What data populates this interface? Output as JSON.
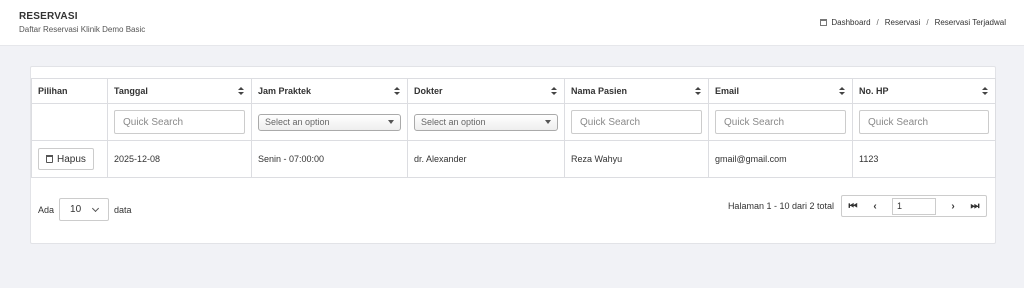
{
  "header": {
    "title": "RESERVASI",
    "subtitle": "Daftar Reservasi Klinik Demo Basic",
    "breadcrumb": [
      "Dashboard",
      "Reservasi",
      "Reservasi Terjadwal"
    ]
  },
  "table": {
    "columns": [
      "Pilihan",
      "Tanggal",
      "Jam Praktek",
      "Dokter",
      "Nama Pasien",
      "Email",
      "No. HP"
    ],
    "filters": {
      "quick_search_placeholder": "Quick Search",
      "select_placeholder": "Select an option"
    },
    "rows": [
      {
        "action": "Hapus",
        "tanggal": "2025-12-08",
        "jam_praktek": "Senin - 07:00:00",
        "dokter": "dr. Alexander",
        "nama_pasien": "Reza Wahyu",
        "email": "gmail@gmail.com",
        "no_hp": "1123"
      }
    ]
  },
  "footer": {
    "length_prefix": "Ada",
    "length_value": "10",
    "length_suffix": "data",
    "page_info": "Halaman 1 - 10 dari 2 total",
    "page_input_value": "1"
  },
  "icons": {
    "first": "⏮",
    "prev": "‹",
    "next": "›",
    "last": "⏭"
  }
}
